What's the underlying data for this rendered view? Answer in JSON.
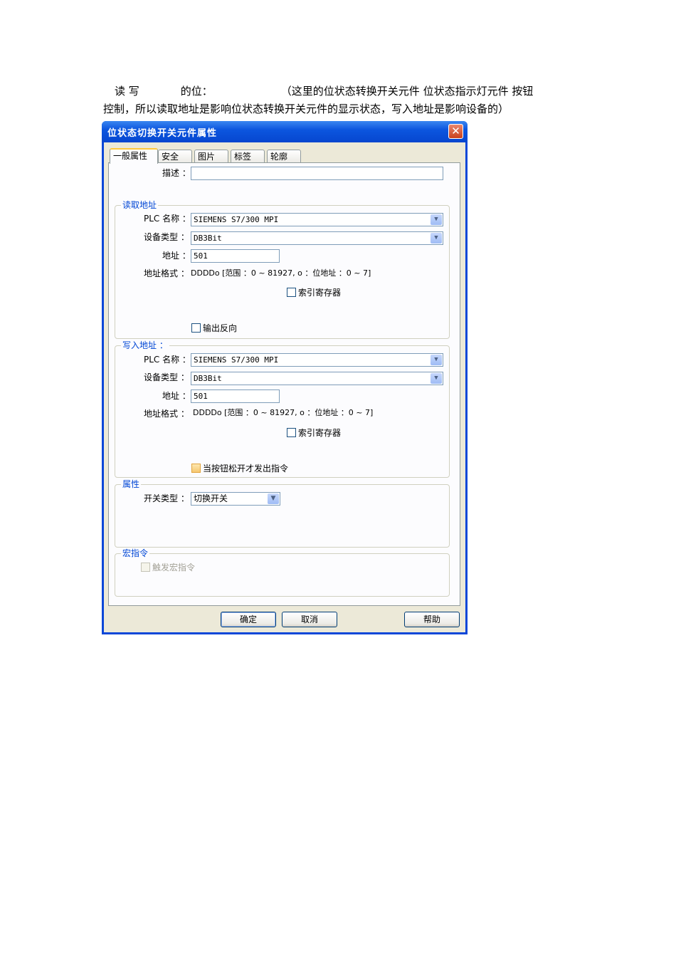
{
  "intro": {
    "line1_a": "读 写",
    "line1_b": "的位：",
    "line1_c": "（这里的位状态转换开关元件 位状态指示灯元件 按钮",
    "line2": "控制，所以读取地址是影响位状态转换开关元件的显示状态，写入地址是影响设备的）"
  },
  "dialog": {
    "title": "位状态切换开关元件属性",
    "close_label": "✕",
    "tabs": [
      "一般属性",
      "安全",
      "图片",
      "标签",
      "轮廓"
    ],
    "description": {
      "label": "描述 ：",
      "value": ""
    },
    "read": {
      "title": "读取地址",
      "plc_label": "PLC 名称 ：",
      "plc_value": "SIEMENS S7/300 MPI",
      "device_label": "设备类型 ：",
      "device_value": "DB3Bit",
      "addr_label": "地址 ：",
      "addr_value": "501",
      "format_label": "地址格式 ：",
      "format_value": "DDDDo [范围 ：0 ~ 81927, o ：位地址 ：0 ~ 7]",
      "index_label": "索引寄存器",
      "invert_label": "输出反向"
    },
    "write": {
      "title": "写入地址 ：",
      "plc_label": "PLC 名称 ：",
      "plc_value": "SIEMENS S7/300 MPI",
      "device_label": "设备类型 ：",
      "device_value": "DB3Bit",
      "addr_label": "地址 ：",
      "addr_value": "501",
      "format_label": "地址格式 ：",
      "format_value": "DDDDo [范围 ：0 ~ 81927, o ：位地址 ：0 ~ 7]",
      "index_label": "索引寄存器",
      "release_label": "当按钮松开才发出指令"
    },
    "attributes": {
      "title": "属性",
      "switch_label": "开关类型 ：",
      "switch_value": "切换开关"
    },
    "macro": {
      "title": "宏指令",
      "trigger_label": "触发宏指令"
    },
    "buttons": {
      "ok": "确定",
      "cancel": "取消",
      "help": "帮助"
    }
  }
}
